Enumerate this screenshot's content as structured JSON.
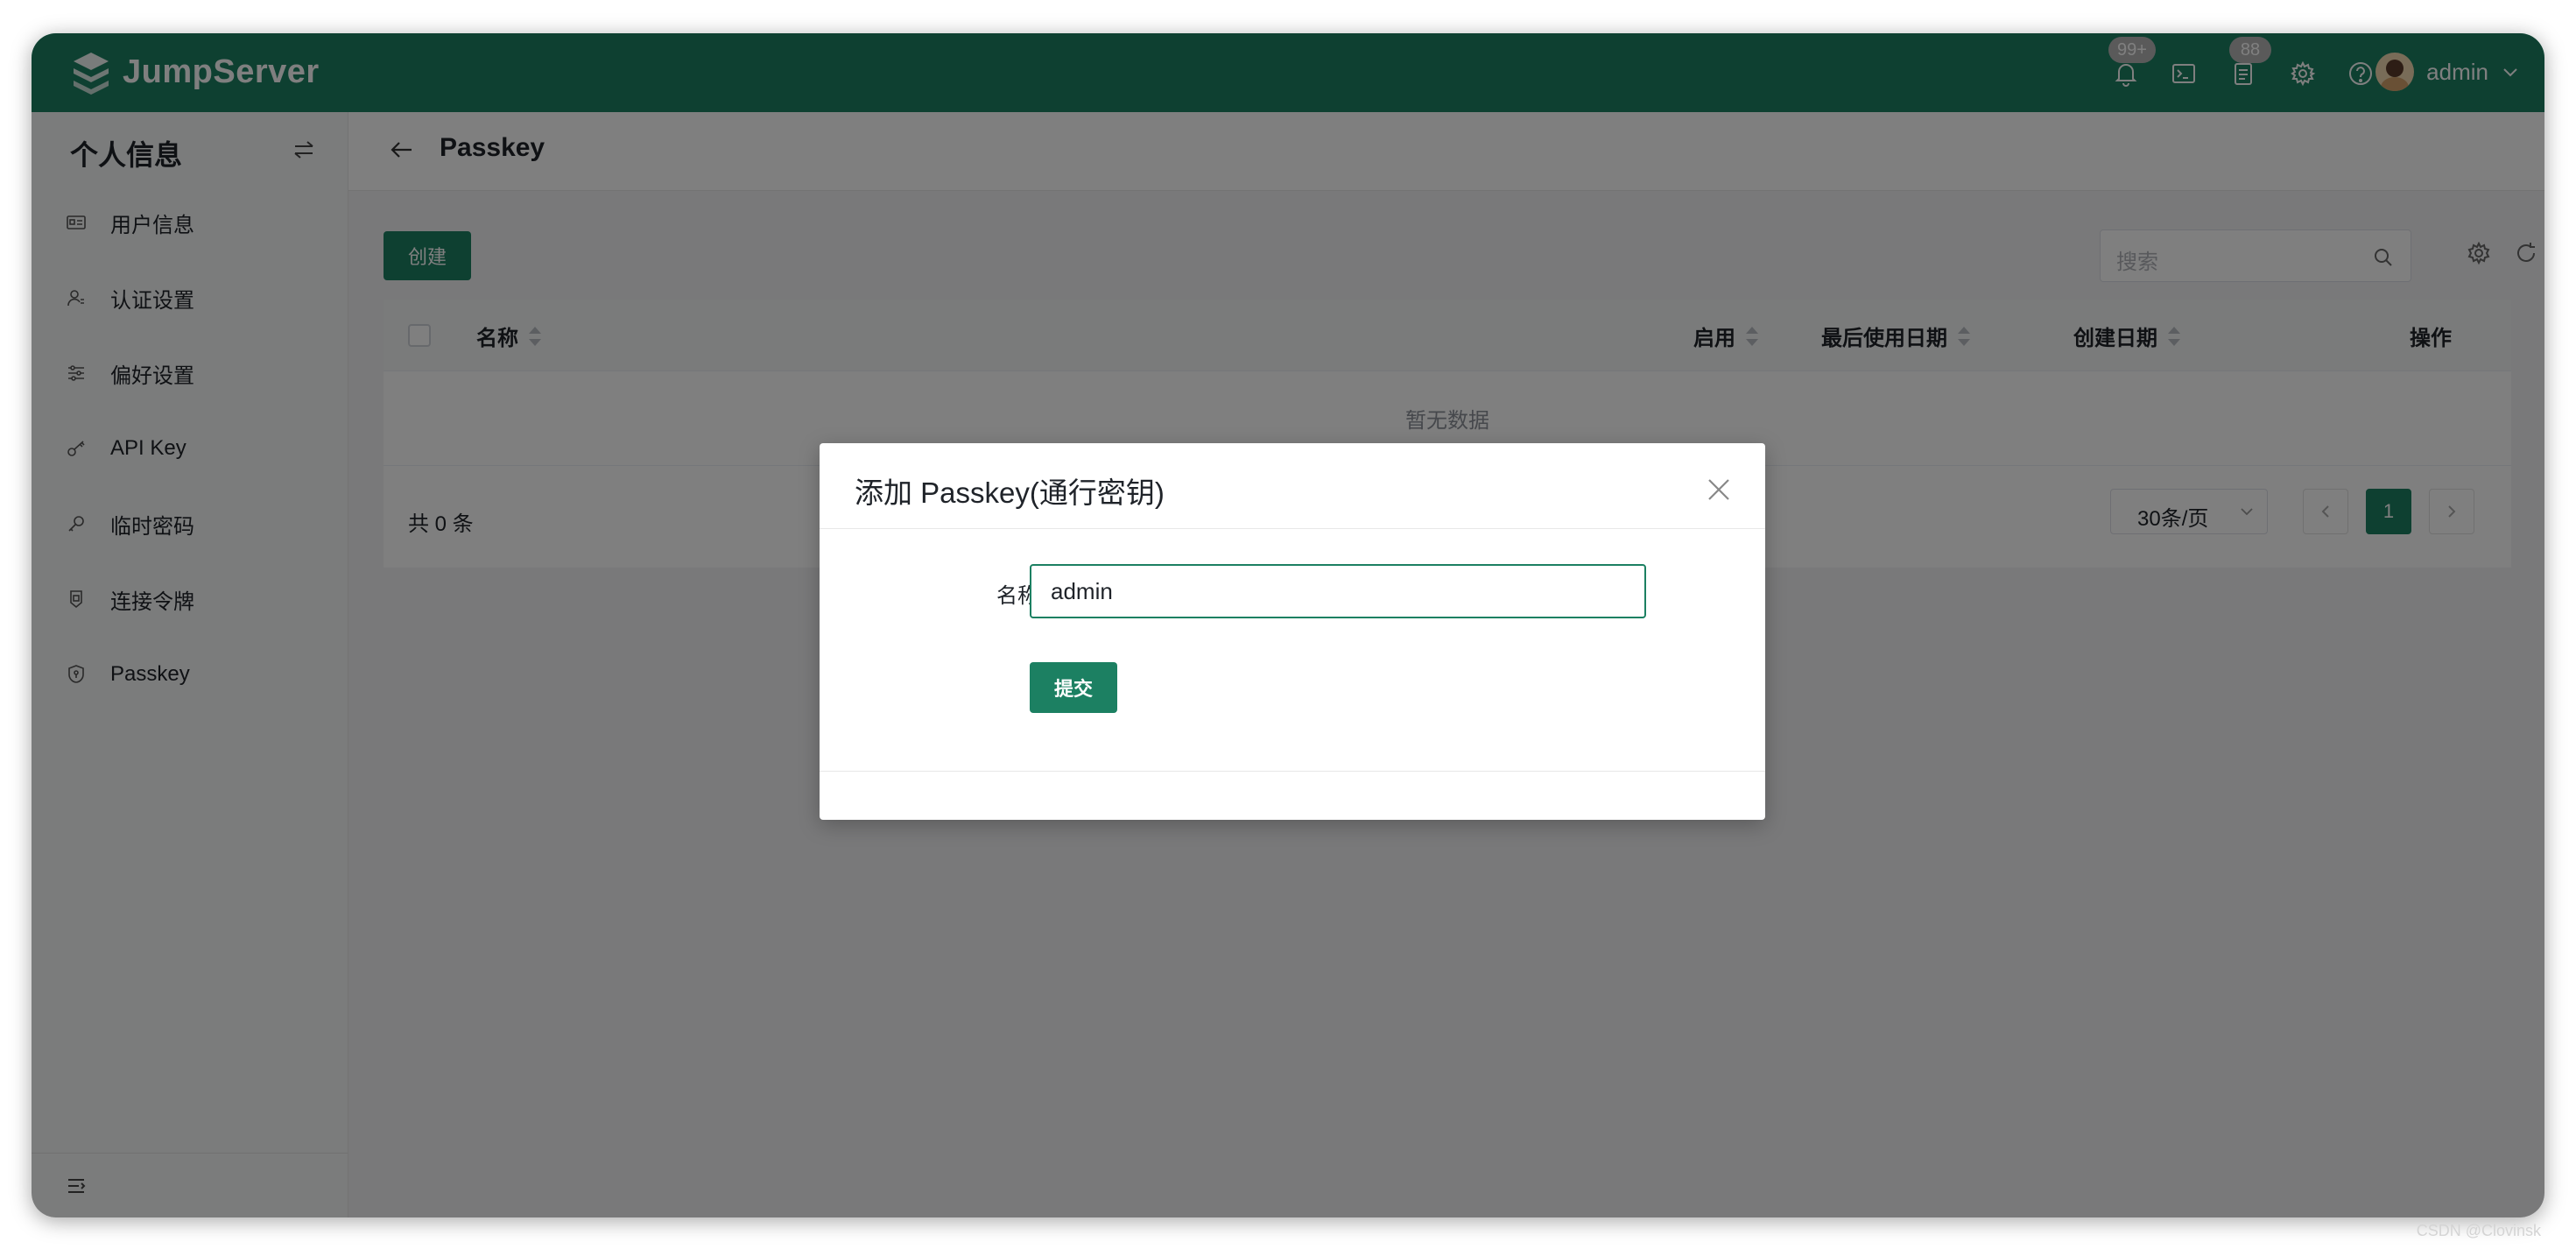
{
  "app": {
    "name": "JumpServer",
    "brand_color": "#1c8062",
    "notification_badge": "99+",
    "tasks_badge": "88",
    "username": "admin"
  },
  "header_icons": [
    "bell-icon",
    "terminal-icon",
    "clipboard-icon",
    "gear-icon",
    "help-icon"
  ],
  "sidebar": {
    "title": "个人信息",
    "items": [
      {
        "label": "用户信息",
        "icon": "id-card-icon"
      },
      {
        "label": "认证设置",
        "icon": "user-auth-icon"
      },
      {
        "label": "偏好设置",
        "icon": "sliders-icon"
      },
      {
        "label": "API Key",
        "icon": "key-icon"
      },
      {
        "label": "临时密码",
        "icon": "wrench-key-icon"
      },
      {
        "label": "连接令牌",
        "icon": "token-icon"
      },
      {
        "label": "Passkey",
        "icon": "shield-icon"
      }
    ]
  },
  "page": {
    "title": "Passkey",
    "create_label": "创建",
    "search_placeholder": "搜索",
    "table": {
      "columns": [
        "名称",
        "启用",
        "最后使用日期",
        "创建日期",
        "操作"
      ],
      "empty_text": "暂无数据"
    },
    "total_label": "共 0 条",
    "page_size_label": "30条/页",
    "current_page": "1"
  },
  "dialog": {
    "title": "添加 Passkey(通行密钥)",
    "name_label": "名称",
    "name_value": "admin",
    "submit_label": "提交"
  },
  "watermark": "CSDN @Clovinsk"
}
